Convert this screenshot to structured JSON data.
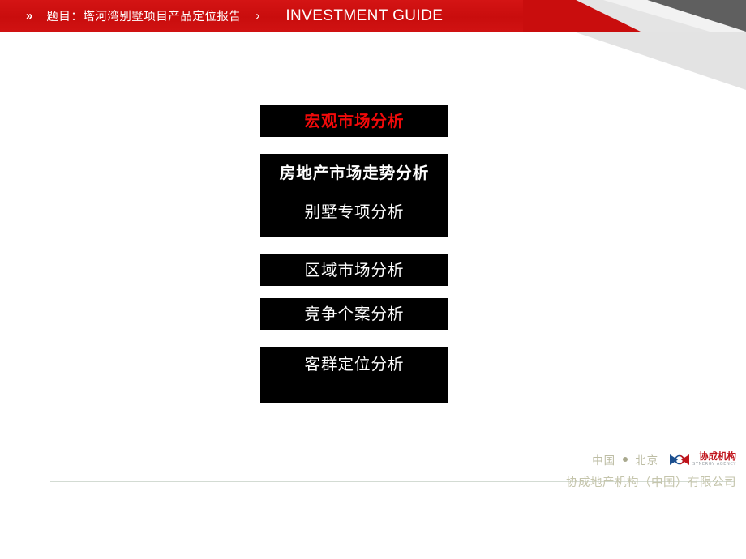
{
  "header": {
    "double_chevron": "»",
    "single_chevron": "›",
    "title": "题目：塔河湾别墅项目产品定位报告",
    "subtitle": "INVESTMENT GUIDE",
    "band_color": "#c90d0d",
    "accent_dark_grey": "#5f5f5f",
    "accent_light_grey": "#e4e4e4"
  },
  "agenda": {
    "items": [
      {
        "label": "宏观市场分析",
        "color": "#f10a0a",
        "active": true
      },
      {
        "label": "房地产市场走势分析",
        "color": "#ffffff",
        "active": false
      },
      {
        "label": "别墅专项分析",
        "color": "#ffffff",
        "active": false
      },
      {
        "label": "区域市场分析",
        "color": "#ffffff",
        "active": false
      },
      {
        "label": "竞争个案分析",
        "color": "#ffffff",
        "active": false
      },
      {
        "label": "客群定位分析",
        "color": "#ffffff",
        "active": false
      }
    ]
  },
  "footer": {
    "city_cn": "中国",
    "city_bj": "北京",
    "separator_icon": "dot-separator",
    "logo": {
      "icon_name": "synergy-agency-logo",
      "name_cn": "协成机构",
      "name_en": "SYNERGY AGENCY",
      "color_red": "#c0141b",
      "color_blue": "#1b4f8f"
    },
    "company": "协成地产机构（中国）有限公司",
    "rule_color": "#d3dbd3"
  }
}
